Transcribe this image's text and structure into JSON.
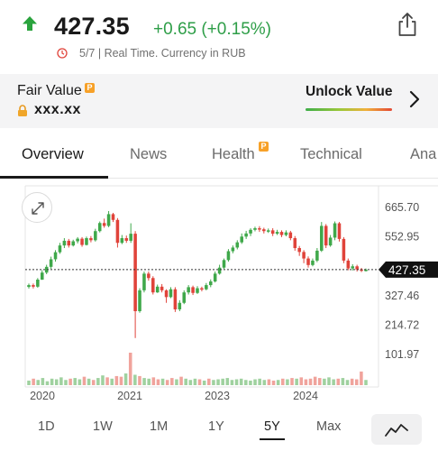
{
  "quote": {
    "price": "427.35",
    "change": "+0.65 (+0.15%)",
    "meta": "5/7 | Real Time. Currency in RUB",
    "direction": "up",
    "up_color": "#2e9e48"
  },
  "fair_value": {
    "title": "Fair Value",
    "badge": "P",
    "value": "xxx.xx",
    "unlock_label": "Unlock Value"
  },
  "tabs": [
    {
      "label": "Overview",
      "active": true
    },
    {
      "label": "News",
      "active": false
    },
    {
      "label": "Health",
      "active": false,
      "badge": "P"
    },
    {
      "label": "Technical",
      "active": false
    },
    {
      "label": "Ana",
      "active": false
    }
  ],
  "ranges": [
    {
      "label": "1D",
      "active": false
    },
    {
      "label": "1W",
      "active": false
    },
    {
      "label": "1M",
      "active": false
    },
    {
      "label": "1Y",
      "active": false
    },
    {
      "label": "5Y",
      "active": true
    },
    {
      "label": "Max",
      "active": false
    }
  ],
  "chart_data": {
    "type": "candlestick",
    "y_ticks": [
      "665.70",
      "552.95",
      "327.46",
      "214.72",
      "101.97"
    ],
    "y_tick_values": [
      665.7,
      552.95,
      327.46,
      214.72,
      101.97
    ],
    "current_price_label": "427.35",
    "current_price": 427.35,
    "x_labels": [
      "2020",
      "2021",
      "2023",
      "2024"
    ],
    "up_color": "#3fa84a",
    "down_color": "#e0433a",
    "candles": [
      [
        361,
        368,
        355,
        374,
        350
      ],
      [
        368,
        362,
        355,
        374,
        350
      ],
      [
        362,
        389,
        358,
        395,
        0
      ],
      [
        389,
        416,
        388,
        425,
        0
      ],
      [
        416,
        438,
        410,
        446,
        0
      ],
      [
        438,
        467,
        430,
        477,
        0
      ],
      [
        467,
        494,
        458,
        502,
        0
      ],
      [
        494,
        520,
        488,
        530,
        0
      ],
      [
        520,
        538,
        510,
        548,
        0
      ],
      [
        538,
        520,
        512,
        545,
        0
      ],
      [
        520,
        536,
        516,
        542,
        0
      ],
      [
        536,
        546,
        528,
        552,
        0
      ],
      [
        546,
        522,
        515,
        552,
        0
      ],
      [
        522,
        548,
        520,
        554,
        0
      ],
      [
        548,
        540,
        532,
        556,
        0
      ],
      [
        540,
        575,
        535,
        584,
        0
      ],
      [
        575,
        606,
        570,
        612,
        0
      ],
      [
        606,
        595,
        588,
        623,
        0
      ],
      [
        595,
        640,
        590,
        652,
        0
      ],
      [
        640,
        618,
        610,
        645,
        0
      ],
      [
        618,
        530,
        512,
        625,
        0
      ],
      [
        530,
        548,
        525,
        560,
        0
      ],
      [
        548,
        538,
        530,
        558,
        0
      ],
      [
        538,
        565,
        530,
        605,
        0
      ],
      [
        565,
        268,
        165,
        575,
        0
      ],
      [
        268,
        348,
        262,
        356,
        0
      ],
      [
        348,
        412,
        340,
        420,
        0
      ],
      [
        412,
        395,
        385,
        420,
        0
      ],
      [
        395,
        340,
        332,
        402,
        0
      ],
      [
        340,
        362,
        338,
        370,
        0
      ],
      [
        362,
        348,
        340,
        372,
        0
      ],
      [
        348,
        322,
        300,
        352,
        0
      ],
      [
        322,
        352,
        318,
        360,
        0
      ],
      [
        352,
        275,
        265,
        360,
        0
      ],
      [
        275,
        300,
        268,
        310,
        0
      ],
      [
        300,
        340,
        295,
        348,
        0
      ],
      [
        340,
        360,
        332,
        368,
        0
      ],
      [
        360,
        338,
        330,
        366,
        0
      ],
      [
        338,
        356,
        334,
        364,
        0
      ],
      [
        356,
        352,
        344,
        362,
        0
      ],
      [
        352,
        368,
        348,
        376,
        0
      ],
      [
        368,
        382,
        360,
        390,
        0
      ],
      [
        382,
        412,
        378,
        420,
        0
      ],
      [
        412,
        435,
        408,
        446,
        0
      ],
      [
        435,
        464,
        430,
        470,
        0
      ],
      [
        464,
        498,
        458,
        506,
        0
      ],
      [
        498,
        512,
        490,
        520,
        0
      ],
      [
        512,
        532,
        505,
        540,
        0
      ],
      [
        532,
        554,
        526,
        566,
        0
      ],
      [
        554,
        566,
        545,
        576,
        0
      ],
      [
        566,
        580,
        556,
        586,
        0
      ],
      [
        580,
        586,
        574,
        592,
        0
      ],
      [
        586,
        582,
        572,
        594,
        0
      ],
      [
        582,
        575,
        566,
        588,
        0
      ],
      [
        575,
        578,
        568,
        585,
        0
      ],
      [
        578,
        565,
        556,
        586,
        0
      ],
      [
        565,
        572,
        560,
        580,
        0
      ],
      [
        572,
        560,
        552,
        578,
        0
      ],
      [
        560,
        570,
        555,
        578,
        0
      ],
      [
        570,
        548,
        540,
        576,
        0
      ],
      [
        548,
        510,
        500,
        556,
        0
      ],
      [
        510,
        495,
        480,
        518,
        0
      ],
      [
        495,
        470,
        452,
        502,
        0
      ],
      [
        470,
        445,
        435,
        478,
        0
      ],
      [
        445,
        462,
        440,
        470,
        0
      ],
      [
        462,
        500,
        456,
        510,
        0
      ],
      [
        500,
        595,
        495,
        610,
        0
      ],
      [
        595,
        520,
        510,
        602,
        0
      ],
      [
        520,
        550,
        515,
        560,
        0
      ],
      [
        550,
        605,
        540,
        612,
        0
      ],
      [
        605,
        545,
        535,
        610,
        0
      ],
      [
        545,
        462,
        452,
        552,
        0
      ],
      [
        462,
        432,
        425,
        470,
        0
      ],
      [
        432,
        440,
        424,
        448,
        0
      ],
      [
        440,
        428,
        420,
        446,
        0
      ],
      [
        428,
        425,
        418,
        434,
        0
      ],
      [
        425,
        427,
        420,
        432,
        0
      ]
    ],
    "volumes": [
      0.14,
      0.2,
      0.16,
      0.22,
      0.12,
      0.2,
      0.18,
      0.24,
      0.16,
      0.2,
      0.22,
      0.18,
      0.26,
      0.2,
      0.16,
      0.22,
      0.3,
      0.24,
      0.2,
      0.28,
      0.26,
      0.36,
      1.0,
      0.32,
      0.28,
      0.22,
      0.2,
      0.24,
      0.18,
      0.2,
      0.16,
      0.22,
      0.18,
      0.26,
      0.2,
      0.16,
      0.2,
      0.18,
      0.14,
      0.2,
      0.16,
      0.18,
      0.2,
      0.22,
      0.16,
      0.18,
      0.2,
      0.16,
      0.14,
      0.18,
      0.2,
      0.16,
      0.18,
      0.14,
      0.16,
      0.2,
      0.18,
      0.22,
      0.2,
      0.24,
      0.18,
      0.2,
      0.26,
      0.22,
      0.2,
      0.24,
      0.18,
      0.2,
      0.22,
      0.16,
      0.2,
      0.18,
      0.42,
      0.16
    ]
  }
}
